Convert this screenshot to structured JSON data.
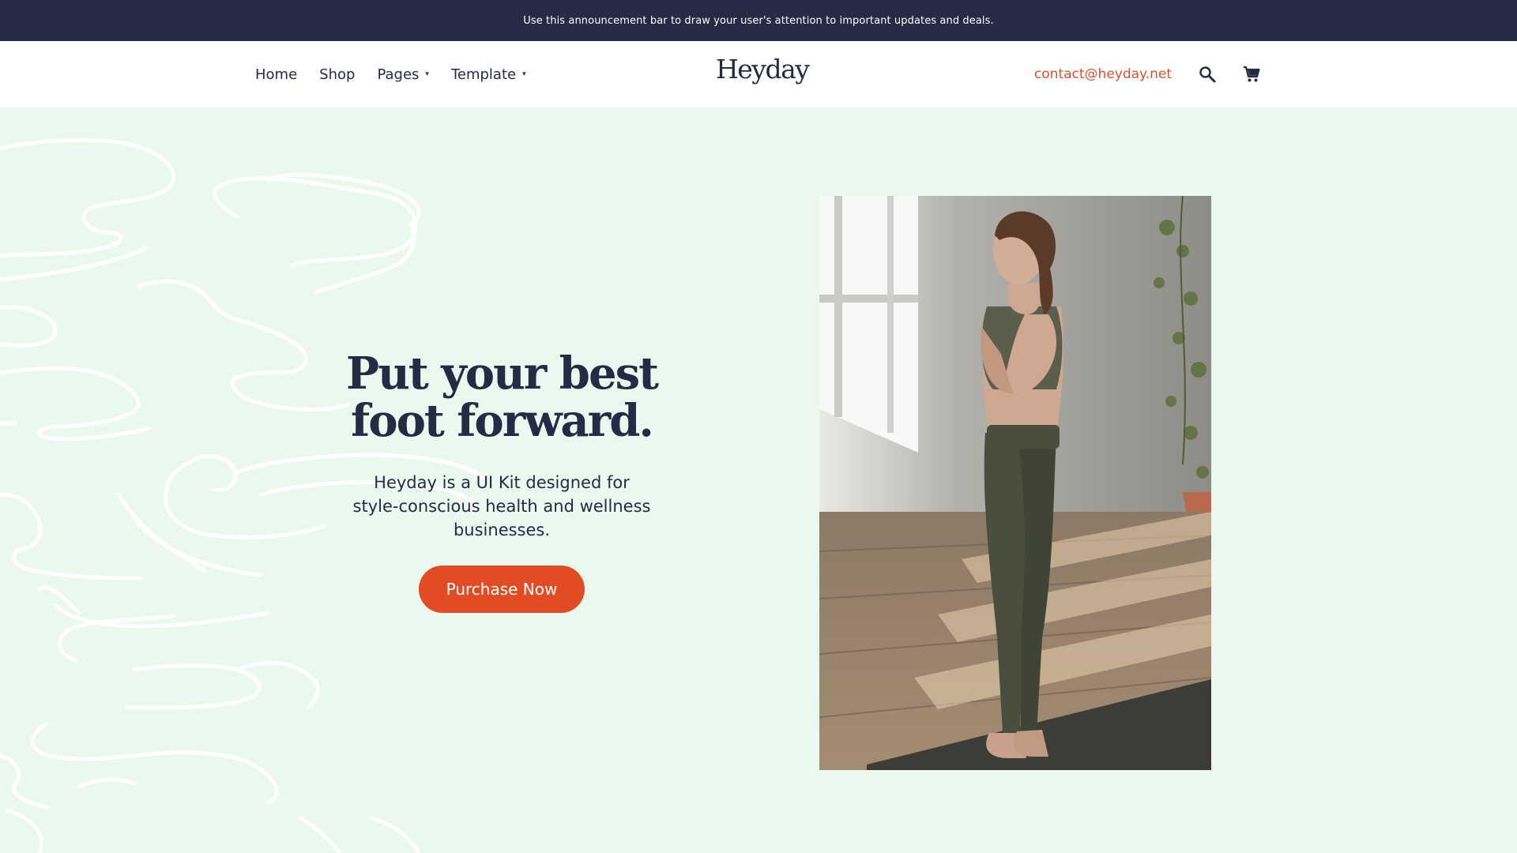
{
  "announcement": {
    "text": "Use this announcement bar to draw your user's attention to important updates and deals."
  },
  "nav": {
    "items": [
      {
        "label": "Home"
      },
      {
        "label": "Shop"
      },
      {
        "label": "Pages",
        "caret": "▾"
      },
      {
        "label": "Template",
        "caret": "▾"
      }
    ]
  },
  "brand": {
    "logo": "Heyday"
  },
  "header_right": {
    "contact": "contact@heyday.net",
    "search_icon": "search-icon",
    "cart_icon": "cart-icon"
  },
  "hero": {
    "title": "Put your best\nfoot forward.",
    "subtitle": "Heyday is a UI Kit designed for style-conscious health and wellness businesses.",
    "cta_label": "Purchase Now",
    "image_subject": "woman in yoga pose with hands in prayer position on a mat"
  },
  "colors": {
    "announcement_bg": "#252b45",
    "text_primary": "#252b45",
    "accent": "#e14c24",
    "contact_link": "#d8532a",
    "hero_bg": "#eaf8ee"
  }
}
